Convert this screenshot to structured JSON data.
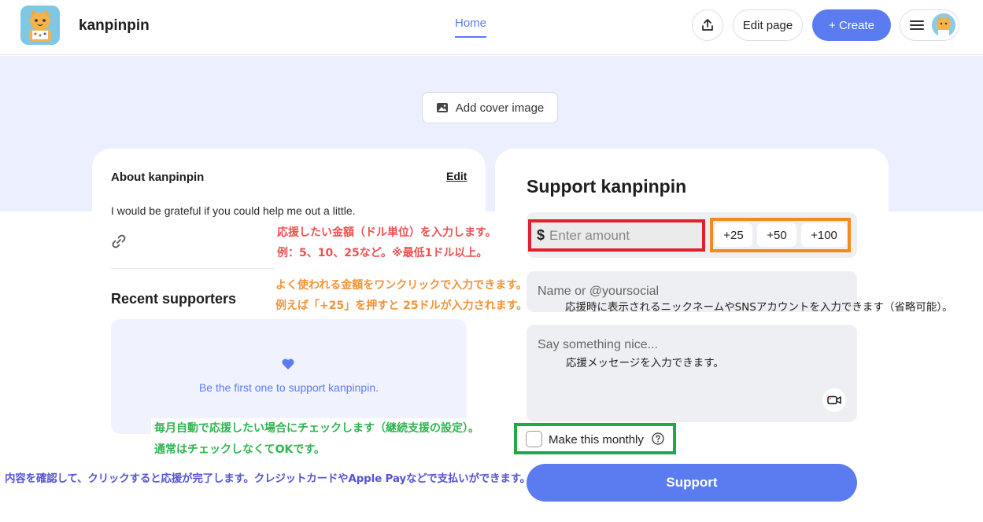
{
  "header": {
    "site_name": "kanpinpin",
    "nav_home": "Home",
    "edit_page": "Edit page",
    "create": "+ Create"
  },
  "cover": {
    "add_cover_label": "Add cover image"
  },
  "about": {
    "title": "About kanpinpin",
    "edit": "Edit",
    "description": "I would be grateful if you could help me out a little.",
    "recent_title": "Recent supporters",
    "empty_text": "Be the first one to support kanpinpin."
  },
  "support": {
    "title": "Support kanpinpin",
    "currency": "$",
    "amount_placeholder": "Enter amount",
    "quick_amounts": [
      "+25",
      "+50",
      "+100"
    ],
    "name_placeholder": "Name or @yoursocial",
    "message_placeholder": "Say something nice...",
    "monthly_label": "Make this monthly",
    "monthly_checked": false,
    "button": "Support"
  },
  "annotations": {
    "amount_line1": "応援したい金額（ドル単位）を入力します。",
    "amount_line2": "例：5、10、25など。※最低1ドル以上。",
    "quick_line1": "よく使われる金額をワンクリックで入力できます。",
    "quick_line2": "例えば「+25」を押すと 25ドルが入力されます。",
    "name_note": "応援時に表示されるニックネームやSNSアカウントを入力できます（省略可能）。",
    "message_note": "応援メッセージを入力できます。",
    "monthly_line1": "毎月自動で応援したい場合にチェックします（継続支援の設定）。",
    "monthly_line2": "通常はチェックしなくてOKです。",
    "support_note": "内容を確認して、クリックすると応援が完了します。クレジットカードやApple Payなどで支払いができます。"
  },
  "colors": {
    "accent": "#5b7cf0",
    "amount_highlight": "#e0202a",
    "quick_highlight": "#f28a1c",
    "monthly_highlight": "#1faa48"
  }
}
